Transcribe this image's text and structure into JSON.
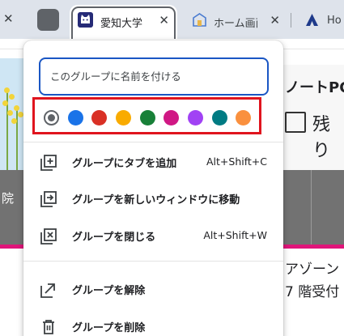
{
  "tabstrip": {
    "active_tab": {
      "title": "愛知大学",
      "favicon": "cat-face-icon"
    },
    "tab2": {
      "title": "ホーム画面",
      "favicon": "home-building-icon"
    },
    "tab3": {
      "title": "Ho",
      "favicon": "triangle-logo-icon"
    },
    "group_color": "#5f6368"
  },
  "popup": {
    "name_input": {
      "placeholder": "このグループに名前を付ける",
      "value": ""
    },
    "colors": [
      {
        "name": "grey",
        "hex": "#5f6368",
        "selected": true
      },
      {
        "name": "blue",
        "hex": "#1a73e8",
        "selected": false
      },
      {
        "name": "red",
        "hex": "#d93025",
        "selected": false
      },
      {
        "name": "yellow",
        "hex": "#f9ab00",
        "selected": false
      },
      {
        "name": "green",
        "hex": "#188038",
        "selected": false
      },
      {
        "name": "pink",
        "hex": "#d01884",
        "selected": false
      },
      {
        "name": "purple",
        "hex": "#a142f4",
        "selected": false
      },
      {
        "name": "cyan",
        "hex": "#007b83",
        "selected": false
      },
      {
        "name": "orange",
        "hex": "#fa903e",
        "selected": false
      }
    ],
    "menu": [
      {
        "id": "add-tab",
        "label": "グループにタブを追加",
        "shortcut": "Alt+Shift+C",
        "icon": "add-box-icon"
      },
      {
        "id": "move-window",
        "label": "グループを新しいウィンドウに移動",
        "shortcut": "",
        "icon": "move-to-window-icon"
      },
      {
        "id": "close-group",
        "label": "グループを閉じる",
        "shortcut": "Alt+Shift+W",
        "icon": "close-box-icon"
      },
      {
        "id": "ungroup",
        "label": "グループを解除",
        "shortcut": "",
        "icon": "ungroup-arrow-icon"
      },
      {
        "id": "delete-group",
        "label": "グループを削除",
        "shortcut": "",
        "icon": "trash-icon"
      }
    ]
  },
  "page": {
    "right_heading": "ノートPC",
    "right_text": "残り",
    "left_label": "院",
    "bottom_text1": "アゾーン",
    "bottom_text2": "7 階受付"
  }
}
